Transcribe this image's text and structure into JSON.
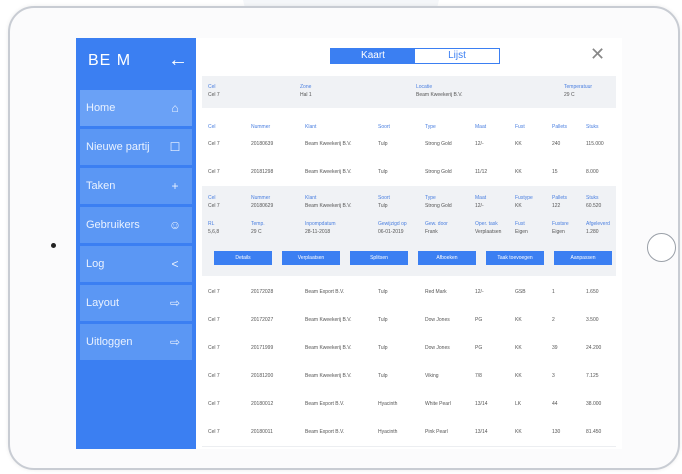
{
  "sidebar": {
    "logo": "BE M",
    "items": [
      {
        "label": "Home",
        "icon": "home-icon",
        "glyph": "⌂"
      },
      {
        "label": "Nieuwe partij",
        "icon": "document-icon",
        "glyph": "☐"
      },
      {
        "label": "Taken",
        "icon": "plus-icon",
        "glyph": "+"
      },
      {
        "label": "Gebruikers",
        "icon": "users-icon",
        "glyph": "☺"
      },
      {
        "label": "Log",
        "icon": "share-icon",
        "glyph": "<"
      },
      {
        "label": "Layout",
        "icon": "exit-icon",
        "glyph": "⇨"
      },
      {
        "label": "Uitloggen",
        "icon": "logout-icon",
        "glyph": "⇨"
      }
    ]
  },
  "toggle": {
    "kaart": "Kaart",
    "lijst": "Lijst"
  },
  "info": {
    "cel_label": "Cel",
    "cel_value": "Cel 7",
    "zone_label": "Zone",
    "zone_value": "Hal 1",
    "locatie_label": "Locatie",
    "locatie_value": "Beam Kweekerij B.V.",
    "temp_label": "Temperatuur",
    "temp_value": "29 C"
  },
  "columns": [
    "Cel",
    "Nummer",
    "Klant",
    "Soort",
    "Type",
    "Maat",
    "Fust",
    "Pallets",
    "Stuks"
  ],
  "rows_top": [
    [
      "Cel 7",
      "20180639",
      "Beam Kweekerij B.V.",
      "Tulp",
      "Strong Gold",
      "12/-",
      "KK",
      "240",
      "115.000"
    ],
    [
      "Cel 7",
      "20181298",
      "Beam Kweekerij B.V.",
      "Tulp",
      "Strong Gold",
      "11/12",
      "KK",
      "15",
      "8.000"
    ]
  ],
  "detail": {
    "row1_labels": [
      "Cel",
      "Nummer",
      "Klant",
      "Soort",
      "Type",
      "Maat",
      "Fustype",
      "Pallets",
      "Stuks"
    ],
    "row1_values": [
      "Cel 7",
      "20180629",
      "Beam Kweekerij B.V.",
      "Tulp",
      "Strong Gold",
      "12/-",
      "KK",
      "122",
      "60.520"
    ],
    "row2_labels": [
      "RL",
      "Temp.",
      "Inpompdatum",
      "Gewijzigd op",
      "Gew. door",
      "Oper. task",
      "Fust",
      "Fustsre",
      "Afgeleverd"
    ],
    "row2_values": [
      "5,6,8",
      "29 C",
      "28-11-2018",
      "06-01-2019",
      "Frank",
      "Verplaatsen",
      "Eigen",
      "Eigen",
      "1.280"
    ],
    "buttons": [
      "Details",
      "Verplaatsen",
      "Splitsen",
      "Afboeken",
      "Taak toevoegen",
      "Aanpassen"
    ]
  },
  "rows_bottom": [
    [
      "Cel 7",
      "20172028",
      "Beam Export B.V.",
      "Tulp",
      "Red Mark",
      "12/-",
      "GSB",
      "1",
      "1.650"
    ],
    [
      "Cel 7",
      "20172027",
      "Beam Kweekerij B.V.",
      "Tulp",
      "Dow Jones",
      "PG",
      "KK",
      "2",
      "3.500"
    ],
    [
      "Cel 7",
      "20171999",
      "Beam Kweekerij B.V.",
      "Tulp",
      "Dow Jones",
      "PG",
      "KK",
      "39",
      "24.200"
    ],
    [
      "Cel 7",
      "20181200",
      "Beam Kweekerij B.V.",
      "Tulp",
      "Viking",
      "7/8",
      "KK",
      "3",
      "7.125"
    ],
    [
      "Cel 7",
      "20180012",
      "Beam Export B.V.",
      "Hyacinth",
      "White Pearl",
      "13/14",
      "LK",
      "44",
      "38.000"
    ],
    [
      "Cel 7",
      "20180011",
      "Beam Export B.V.",
      "Hyacinth",
      "Pink Pearl",
      "13/14",
      "KK",
      "130",
      "81.450"
    ]
  ]
}
